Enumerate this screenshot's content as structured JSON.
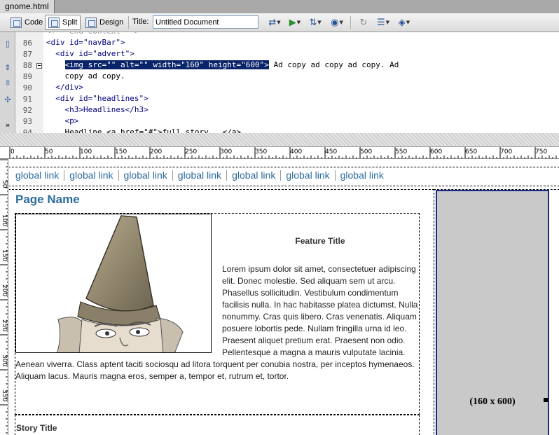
{
  "document_tab": {
    "label": "gnome.html"
  },
  "toolbar": {
    "code_label": "Code",
    "split_label": "Split",
    "design_label": "Design",
    "title_label": "Title:",
    "title_value": "Untitled Document"
  },
  "code": {
    "lines": [
      {
        "num": "86",
        "text": "<div id=\"navBar\">"
      },
      {
        "num": "87",
        "text": "  <div id=\"advert\">"
      },
      {
        "num": "88",
        "sel": "<img src=\"\" alt=\"\" width=\"160\" height=\"600\">",
        "rest": " Ad copy ad copy ad copy. Ad"
      },
      {
        "num": "89",
        "text": "    copy ad copy."
      },
      {
        "num": "90",
        "text": "  </div>"
      },
      {
        "num": "91",
        "text": "  <div id=\"headlines\">"
      },
      {
        "num": "92",
        "text": "    <h3>Headlines</h3>"
      },
      {
        "num": "93",
        "text": "    <p>"
      },
      {
        "num": "94",
        "text": "    Headline <a href=\"#\">full story...</a>"
      }
    ],
    "partial_top": "<!-- end content -->"
  },
  "ruler": {
    "ticks": [
      "0",
      "50",
      "100",
      "150",
      "200",
      "250",
      "300",
      "350",
      "400",
      "450",
      "500",
      "550",
      "600",
      "650",
      "700",
      "750"
    ]
  },
  "vruler": {
    "ticks": [
      "50",
      "100",
      "150",
      "200",
      "250",
      "300",
      "350"
    ]
  },
  "design": {
    "nav_links": [
      "global link",
      "global link",
      "global link",
      "global link",
      "global link",
      "global link",
      "global link"
    ],
    "page_name": "Page Name",
    "feature_title": "Feature Title",
    "feature_text": "Lorem ipsum dolor sit amet, consectetuer adipiscing elit. Donec molestie. Sed aliquam sem ut arcu. Phasellus sollicitudin. Vestibulum condimentum facilisis nulla. In hac habitasse platea dictumst. Nulla nonummy. Cras quis libero. Cras venenatis. Aliquam posuere lobortis pede. Nullam fringilla urna id leo. Praesent aliquet pretium erat. Praesent non odio. Pellentesque a magna a mauris vulputate lacinia. Aenean viverra. Class aptent taciti sociosqu ad litora torquent per conubia nostra, per inceptos hymenaeos. Aliquam lacus. Mauris magna eros, semper a, tempor et, rutrum et, tortor.",
    "story_title": "Story Title",
    "advert_label": "(160 x 600)"
  },
  "colors": {
    "link": "#2c6a9b",
    "page_name": "#2a6b9c",
    "selection": "#0a246a",
    "advert_bg": "#c9c9c9",
    "advert_border": "#1a2a8c"
  }
}
